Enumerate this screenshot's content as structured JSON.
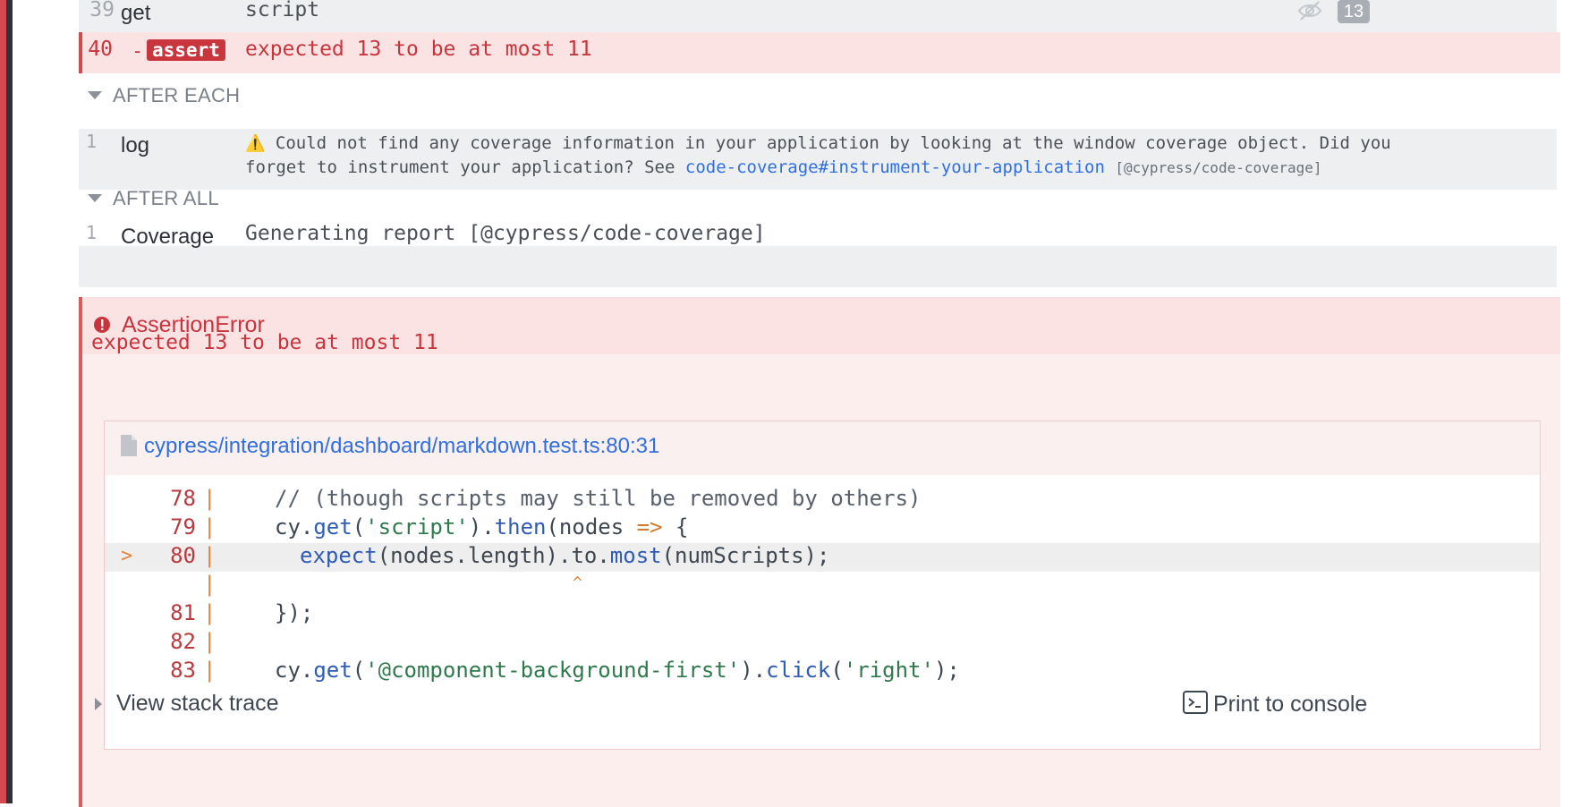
{
  "commands": {
    "row39": {
      "num": "39",
      "name": "get",
      "message": "script",
      "count": "13"
    },
    "row40": {
      "num": "40",
      "prefix": "-",
      "name": "assert",
      "message": "expected 13 to be at most 11"
    }
  },
  "after_each": {
    "header": "AFTER EACH",
    "rows": [
      {
        "num": "1",
        "name": "log",
        "warning_icon": "⚠️",
        "line1": "Could not find any coverage information in your application by looking at the window coverage object. Did you",
        "line2": "forget to instrument your application? See",
        "link": "code-coverage#instrument-your-application",
        "tag": "[@cypress/code-coverage]"
      }
    ]
  },
  "after_all": {
    "header": "AFTER ALL",
    "rows": [
      {
        "num": "1",
        "name": "Coverage",
        "message": "Generating report [@cypress/code-coverage]"
      }
    ]
  },
  "error": {
    "title": "AssertionError",
    "message": "expected 13 to be at most 11",
    "file": "cypress/integration/dashboard/markdown.test.ts:80:31",
    "code_lines": [
      {
        "num": "78",
        "marker": "",
        "bar": "|"
      },
      {
        "num": "79",
        "marker": "",
        "bar": "|"
      },
      {
        "num": "80",
        "marker": ">",
        "bar": "|"
      },
      {
        "num": "",
        "marker": "",
        "bar": "|"
      },
      {
        "num": "81",
        "marker": "",
        "bar": "|"
      },
      {
        "num": "82",
        "marker": "",
        "bar": "|"
      },
      {
        "num": "83",
        "marker": "",
        "bar": "|"
      }
    ],
    "src": {
      "l78": "// (though scripts may still be removed by others)",
      "l79_a": "cy.",
      "l79_b": "get",
      "l79_c": "(",
      "l79_d": "'script'",
      "l79_e": ").",
      "l79_f": "then",
      "l79_g": "(nodes ",
      "l79_h": "=>",
      "l79_i": " {",
      "l80_a": "expect",
      "l80_b": "(nodes.length).to.",
      "l80_c": "most",
      "l80_d": "(numScripts);",
      "caret": "^",
      "l81": "});",
      "l83_a": "cy.",
      "l83_b": "get",
      "l83_c": "(",
      "l83_d": "'@component-background-first'",
      "l83_e": ").",
      "l83_f": "click",
      "l83_g": "(",
      "l83_h": "'right'",
      "l83_i": ");"
    },
    "view_stack_trace": "View stack trace",
    "print_to_console": "Print to console"
  },
  "colors": {
    "error_red": "#c8353d",
    "link_blue": "#2f6fe0",
    "row_bg": "#eeeff1",
    "error_bg": "#fdeeee"
  }
}
